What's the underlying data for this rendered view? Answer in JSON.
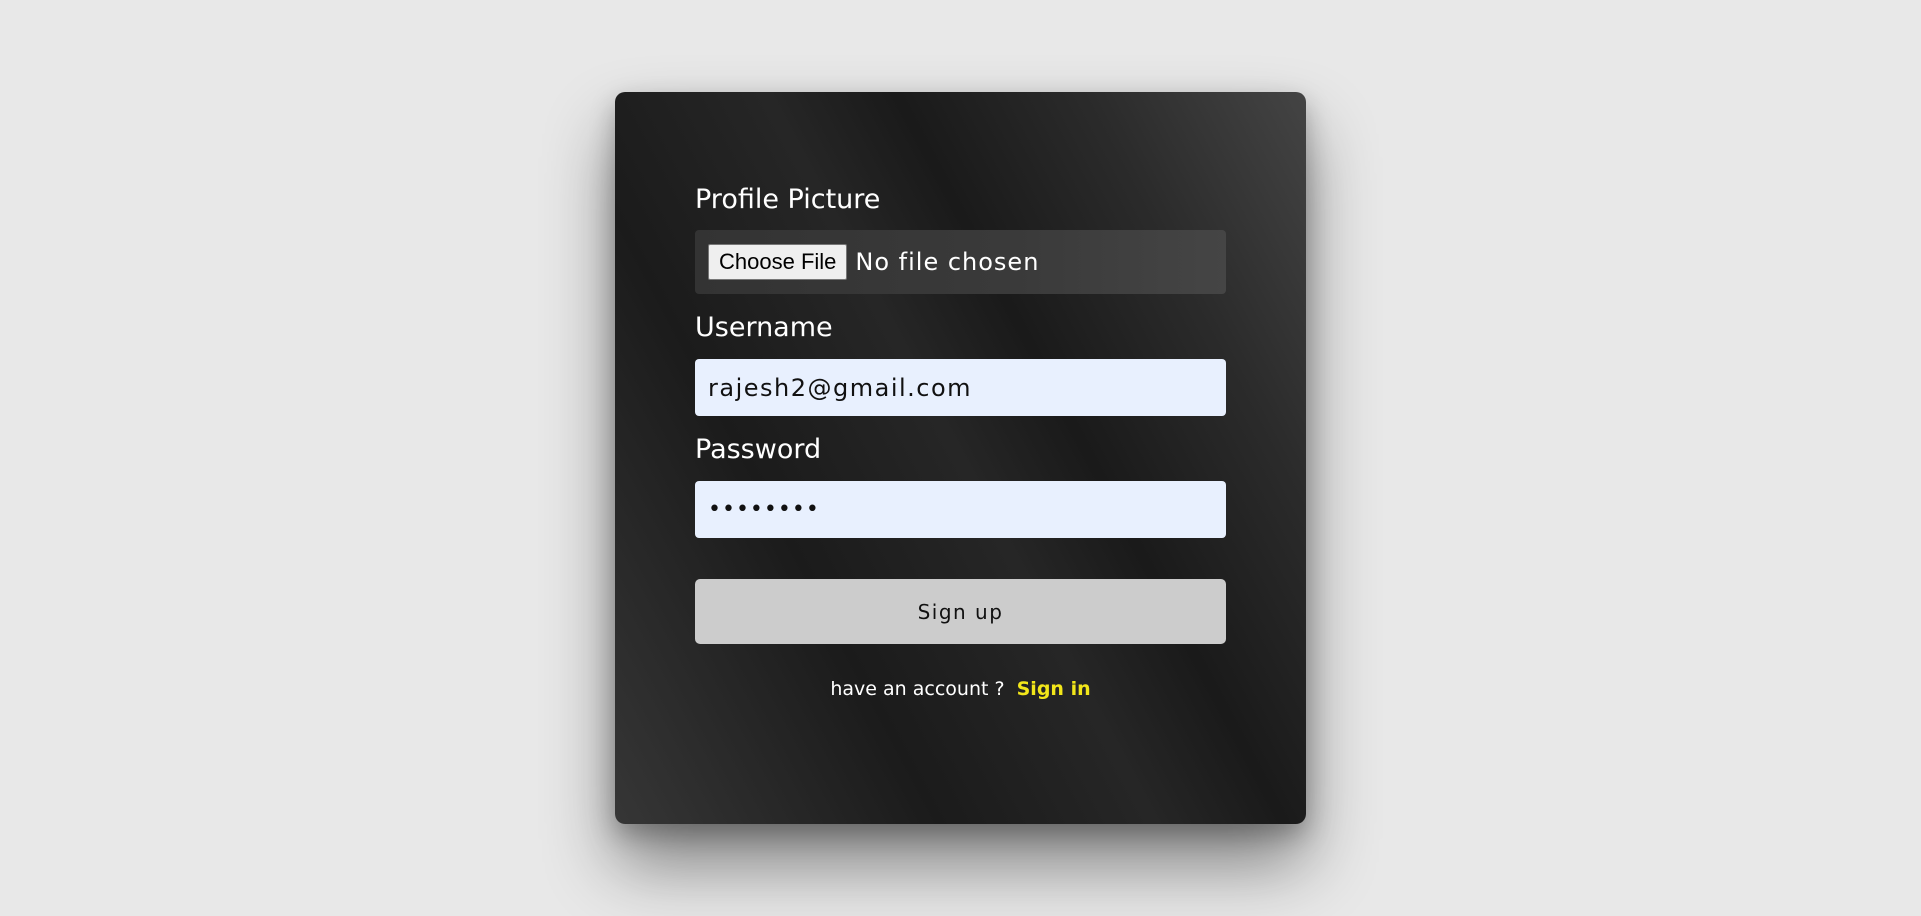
{
  "form": {
    "profile_label": "Profile Picture",
    "file_button_label": "Choose File",
    "file_status": "No file chosen",
    "username_label": "Username",
    "username_value": "rajesh2@gmail.com",
    "password_label": "Password",
    "password_value": "rajesh12",
    "submit_label": "Sign up",
    "footer_text": "have an account ?",
    "signin_link": "Sign in"
  },
  "colors": {
    "page_background": "#e8e8e8",
    "input_background": "#e8f0fe",
    "button_background": "#cccccc",
    "link": "#f2e61a"
  }
}
